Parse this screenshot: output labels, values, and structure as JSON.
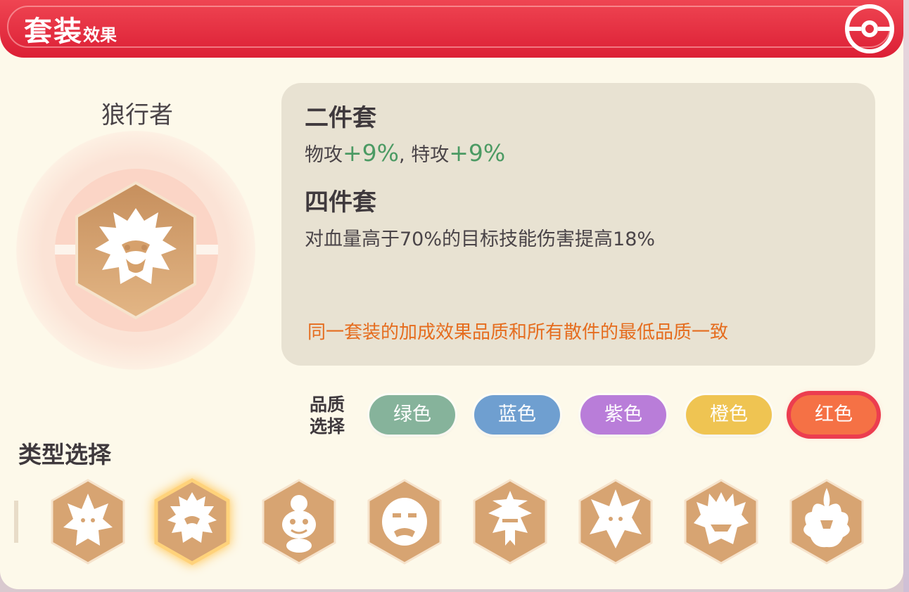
{
  "header": {
    "title_main": "套装",
    "title_sub": "效果"
  },
  "set": {
    "name": "狼行者"
  },
  "two_piece": {
    "title": "二件套",
    "stat1_label": "物攻",
    "stat1_value": "+9%",
    "separator": ",",
    "stat2_label": "特攻",
    "stat2_value": "+9%"
  },
  "four_piece": {
    "title": "四件套",
    "description": "对血量高于70%的目标技能伤害提高18%"
  },
  "note": "同一套装的加成效果品质和所有散件的最低品质一致",
  "quality": {
    "label_line1": "品质",
    "label_line2": "选择",
    "options": [
      {
        "label": "绿色",
        "color": "#86b39b"
      },
      {
        "label": "蓝色",
        "color": "#6f9fd0"
      },
      {
        "label": "紫色",
        "color": "#b97dd9"
      },
      {
        "label": "橙色",
        "color": "#efc452"
      },
      {
        "label": "红色",
        "color": "#f57145"
      }
    ],
    "selected": "红色"
  },
  "types": {
    "title": "类型选择",
    "icons": [
      "lucario-emblem-icon",
      "lion-emblem-icon",
      "charmander-emblem-icon",
      "golem-emblem-icon",
      "beetle-emblem-icon",
      "lucario-alt-emblem-icon",
      "gengar-emblem-icon",
      "flame-beast-emblem-icon"
    ],
    "selected_index": 1
  },
  "colors": {
    "header_red": "#dc1f35",
    "panel_bg": "#fdf9ea",
    "bonus_green": "#4b9a63",
    "note_orange": "#e56c1e",
    "emblem_bronze": "#d19c65"
  }
}
